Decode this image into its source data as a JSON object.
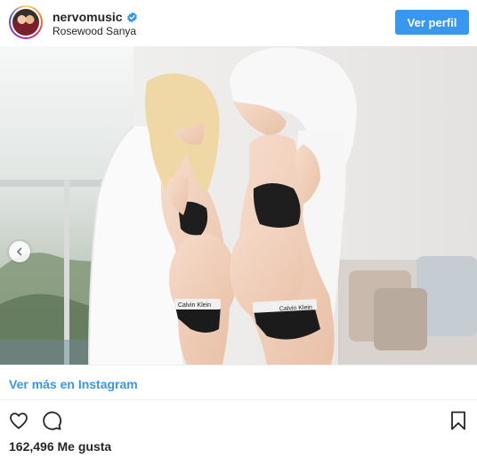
{
  "header": {
    "username": "nervomusic",
    "verified_icon": "verified-badge-icon",
    "location": "Rosewood Sanya",
    "view_profile_label": "Ver perfil"
  },
  "post": {
    "photo": {
      "waistband_text_left": "Calvin Klein",
      "waistband_text_right": "Calvin Klein",
      "carousel_prev_icon": "chevron-left-icon"
    },
    "view_more_label": "Ver más en Instagram",
    "actions": {
      "like_icon": "heart-icon",
      "comment_icon": "comment-icon",
      "save_icon": "bookmark-icon"
    },
    "likes_text": "162,496 Me gusta"
  },
  "colors": {
    "accent": "#3897f0",
    "text": "#262626",
    "divider": "#efefef"
  }
}
